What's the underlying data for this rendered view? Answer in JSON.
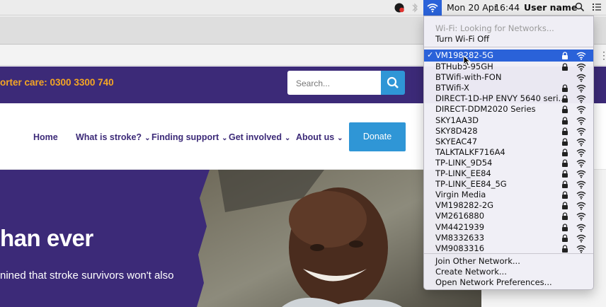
{
  "menubar": {
    "date": "Mon 20 Apr",
    "time": "16:44",
    "user": "User name"
  },
  "site": {
    "care_line": "orter care: 0300 3300 740",
    "search_placeholder": "Search...",
    "nav": [
      "Home",
      "What is stroke?",
      "Finding support",
      "Get involved",
      "About us"
    ],
    "donate_label": "Donate",
    "hero_title": "han ever",
    "hero_sub": "nined that stroke survivors won't also"
  },
  "wifi_menu": {
    "status": "Wi-Fi: Looking for Networks...",
    "turn_off": "Turn Wi-Fi Off",
    "connected_network": "VM198282-5G",
    "networks": [
      {
        "name": "BTHub5-95GH",
        "locked": true
      },
      {
        "name": "BTWifi-with-FON",
        "locked": false
      },
      {
        "name": "BTWifi-X",
        "locked": true
      },
      {
        "name": "DIRECT-1D-HP ENVY 5640 seri...",
        "locked": true
      },
      {
        "name": "DIRECT-DDM2020 Series",
        "locked": true
      },
      {
        "name": "SKY1AA3D",
        "locked": true
      },
      {
        "name": "SKY8D428",
        "locked": true
      },
      {
        "name": "SKYEAC47",
        "locked": true
      },
      {
        "name": "TALKTALKF716A4",
        "locked": true
      },
      {
        "name": "TP-LINK_9D54",
        "locked": true
      },
      {
        "name": "TP-LINK_EE84",
        "locked": true
      },
      {
        "name": "TP-LINK_EE84_5G",
        "locked": true
      },
      {
        "name": "Virgin Media",
        "locked": true
      },
      {
        "name": "VM198282-2G",
        "locked": true
      },
      {
        "name": "VM2616880",
        "locked": true
      },
      {
        "name": "VM4421939",
        "locked": true
      },
      {
        "name": "VM8332633",
        "locked": true
      },
      {
        "name": "VM9083316",
        "locked": true
      }
    ],
    "join_other": "Join Other Network...",
    "create": "Create Network...",
    "preferences": "Open Network Preferences..."
  },
  "colors": {
    "brand_purple": "#3c2a78",
    "brand_blue": "#2f96d6",
    "care_orange": "#f5a623",
    "menu_highlight": "#2a62d9"
  }
}
